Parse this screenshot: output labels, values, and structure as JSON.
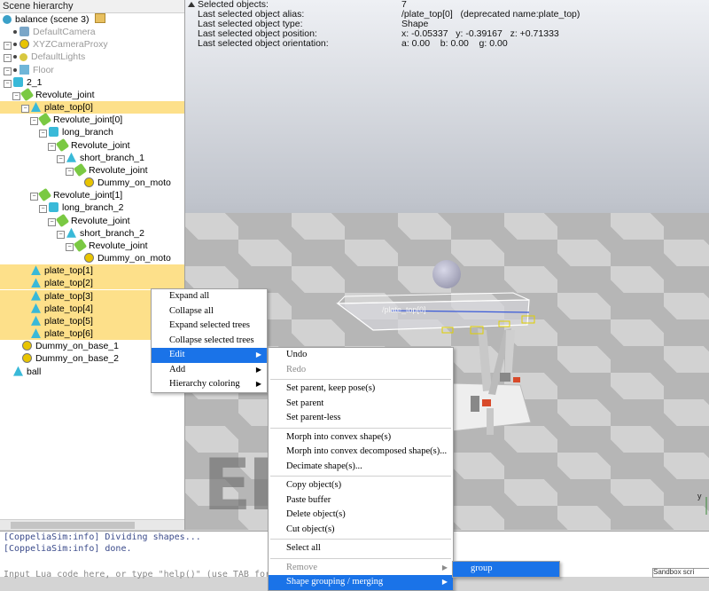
{
  "hierarchy": {
    "title": "Scene hierarchy",
    "scene_label": "balance (scene 3)",
    "items": [
      {
        "label": "DefaultCamera",
        "indent": 0,
        "gray": true,
        "sel": false,
        "icon": "camera-icon",
        "kind": "cam",
        "exp": false
      },
      {
        "label": "XYZCameraProxy",
        "indent": 0,
        "gray": true,
        "sel": false,
        "icon": "dummy-icon",
        "kind": "dummy",
        "exp": true
      },
      {
        "label": "DefaultLights",
        "indent": 0,
        "gray": true,
        "sel": false,
        "icon": "light-icon",
        "kind": "light",
        "exp": true
      },
      {
        "label": "Floor",
        "indent": 0,
        "gray": true,
        "sel": false,
        "icon": "floor-icon",
        "kind": "floor",
        "exp": true
      },
      {
        "label": "2_1",
        "indent": 0,
        "gray": false,
        "sel": false,
        "icon": "model-icon",
        "kind": "model",
        "exp": true
      },
      {
        "label": "Revolute_joint",
        "indent": 1,
        "gray": false,
        "sel": false,
        "icon": "joint-icon",
        "kind": "joint",
        "exp": true
      },
      {
        "label": "plate_top[0]",
        "indent": 2,
        "gray": false,
        "sel": true,
        "icon": "shape-icon",
        "kind": "shape",
        "exp": true
      },
      {
        "label": "Revolute_joint[0]",
        "indent": 3,
        "gray": false,
        "sel": false,
        "icon": "joint-icon",
        "kind": "joint",
        "exp": true
      },
      {
        "label": "long_branch",
        "indent": 4,
        "gray": false,
        "sel": false,
        "icon": "shape-icon",
        "kind": "model",
        "exp": true
      },
      {
        "label": "Revolute_joint",
        "indent": 5,
        "gray": false,
        "sel": false,
        "icon": "joint-icon",
        "kind": "joint",
        "exp": true
      },
      {
        "label": "short_branch_1",
        "indent": 6,
        "gray": false,
        "sel": false,
        "icon": "shape-icon",
        "kind": "shape",
        "exp": true
      },
      {
        "label": "Revolute_joint",
        "indent": 7,
        "gray": false,
        "sel": false,
        "icon": "joint-icon",
        "kind": "joint",
        "exp": true
      },
      {
        "label": "Dummy_on_moto",
        "indent": 8,
        "gray": false,
        "sel": false,
        "icon": "dummy-icon",
        "kind": "dummy",
        "exp": false
      },
      {
        "label": "Revolute_joint[1]",
        "indent": 3,
        "gray": false,
        "sel": false,
        "icon": "joint-icon",
        "kind": "joint",
        "exp": true
      },
      {
        "label": "long_branch_2",
        "indent": 4,
        "gray": false,
        "sel": false,
        "icon": "shape-icon",
        "kind": "model",
        "exp": true
      },
      {
        "label": "Revolute_joint",
        "indent": 5,
        "gray": false,
        "sel": false,
        "icon": "joint-icon",
        "kind": "joint",
        "exp": true
      },
      {
        "label": "short_branch_2",
        "indent": 6,
        "gray": false,
        "sel": false,
        "icon": "shape-icon",
        "kind": "shape",
        "exp": true
      },
      {
        "label": "Revolute_joint",
        "indent": 7,
        "gray": false,
        "sel": false,
        "icon": "joint-icon",
        "kind": "joint",
        "exp": true
      },
      {
        "label": "Dummy_on_moto",
        "indent": 8,
        "gray": false,
        "sel": false,
        "icon": "dummy-icon",
        "kind": "dummy",
        "exp": false
      },
      {
        "label": "plate_top[1]",
        "indent": 2,
        "gray": false,
        "sel": true,
        "icon": "shape-icon",
        "kind": "shape",
        "exp": false
      },
      {
        "label": "plate_top[2]",
        "indent": 2,
        "gray": false,
        "sel": true,
        "icon": "shape-icon",
        "kind": "shape",
        "exp": false
      },
      {
        "label": "plate_top[3]",
        "indent": 2,
        "gray": false,
        "sel": true,
        "icon": "shape-icon",
        "kind": "shape",
        "exp": false
      },
      {
        "label": "plate_top[4]",
        "indent": 2,
        "gray": false,
        "sel": true,
        "icon": "shape-icon",
        "kind": "shape",
        "exp": false
      },
      {
        "label": "plate_top[5]",
        "indent": 2,
        "gray": false,
        "sel": true,
        "icon": "shape-icon",
        "kind": "shape",
        "exp": false
      },
      {
        "label": "plate_top[6]",
        "indent": 2,
        "gray": false,
        "sel": true,
        "icon": "shape-icon",
        "kind": "shape",
        "exp": false
      },
      {
        "label": "Dummy_on_base_1",
        "indent": 1,
        "gray": false,
        "sel": false,
        "icon": "dummy-icon",
        "kind": "dummy",
        "exp": false
      },
      {
        "label": "Dummy_on_base_2",
        "indent": 1,
        "gray": false,
        "sel": false,
        "icon": "dummy-icon",
        "kind": "dummy",
        "exp": false
      },
      {
        "label": "ball",
        "indent": 0,
        "gray": false,
        "sel": false,
        "icon": "shape-icon",
        "kind": "shape",
        "exp": false
      }
    ]
  },
  "info": {
    "rows": [
      {
        "key": "Selected objects:",
        "value": "7"
      },
      {
        "key": "Last selected object alias:",
        "value": "/plate_top[0]   (deprecated name:plate_top)"
      },
      {
        "key": "Last selected object type:",
        "value": "Shape"
      },
      {
        "key": "Last selected object position:",
        "value": "x: -0.05337   y: -0.39167   z: +0.71333"
      },
      {
        "key": "Last selected object orientation:",
        "value": "a: 0.00    b: 0.00    g: 0.00"
      }
    ]
  },
  "viewport": {
    "watermark": "ED",
    "plate_label": "/plate_top[0]",
    "axis_label": "y"
  },
  "console": {
    "lines": [
      "[CoppeliaSim:info] Dividing shapes...",
      "[CoppeliaSim:info] done."
    ],
    "input_placeholder": "Input Lua code here, or type \"help()\" (use TAB for auto-completion)",
    "status": "Sandbox scri"
  },
  "menu_main": [
    {
      "label": "Expand all",
      "sub": false
    },
    {
      "label": "Collapse all",
      "sub": false
    },
    {
      "label": "Expand selected trees",
      "sub": false
    },
    {
      "label": "Collapse selected trees",
      "sub": false
    },
    {
      "label": "Edit",
      "sub": true,
      "hl": true
    },
    {
      "label": "Add",
      "sub": true
    },
    {
      "label": "Hierarchy coloring",
      "sub": true
    }
  ],
  "menu_edit": [
    {
      "label": "Undo"
    },
    {
      "label": "Redo",
      "dis": true
    },
    {
      "sep": true
    },
    {
      "label": "Set parent, keep pose(s)"
    },
    {
      "label": "Set parent"
    },
    {
      "label": "Set parent-less"
    },
    {
      "sep": true
    },
    {
      "label": "Morph into convex shape(s)"
    },
    {
      "label": "Morph into convex decomposed shape(s)..."
    },
    {
      "label": "Decimate shape(s)..."
    },
    {
      "sep": true
    },
    {
      "label": "Copy object(s)"
    },
    {
      "label": "Paste buffer"
    },
    {
      "label": "Delete object(s)"
    },
    {
      "label": "Cut object(s)"
    },
    {
      "sep": true
    },
    {
      "label": "Select all"
    },
    {
      "sep": true
    },
    {
      "label": "Remove",
      "dis": true,
      "sub": true
    },
    {
      "label": "Shape grouping / merging",
      "sub": true,
      "hl": true
    }
  ],
  "menu_group": [
    {
      "label": "group",
      "hl": true
    }
  ],
  "colors": {
    "selection": "#fde08a",
    "menu_highlight": "#1a73e8"
  }
}
